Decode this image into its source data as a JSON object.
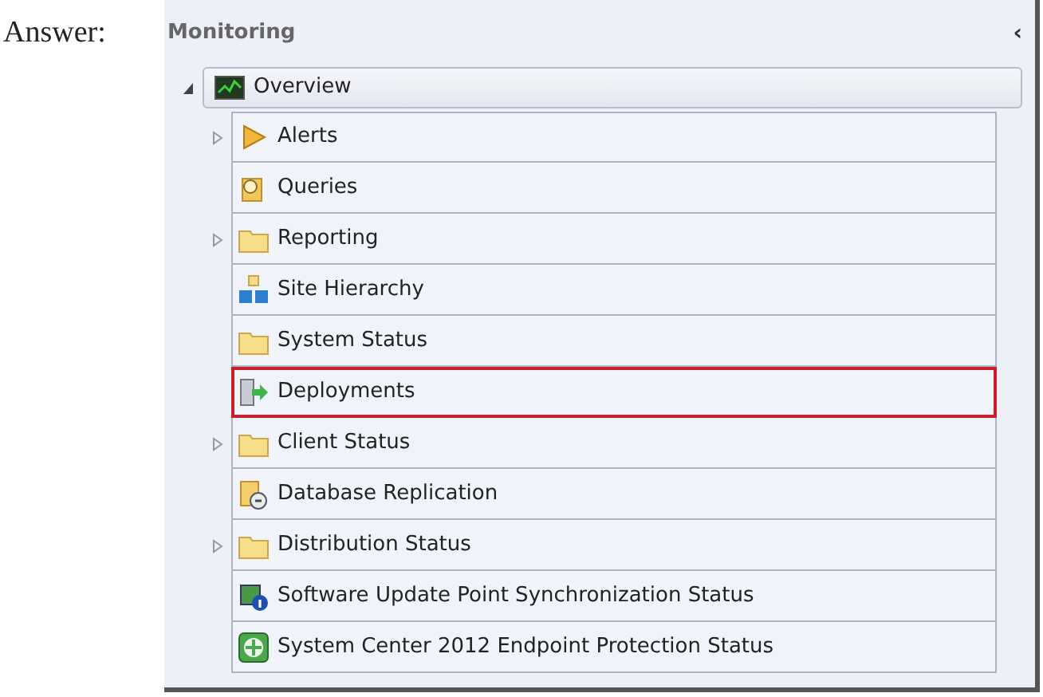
{
  "caption": "Answer:",
  "panel": {
    "title": "Monitoring",
    "collapse_glyph": "‹"
  },
  "tree": [
    {
      "label": "Overview",
      "kind": "overview",
      "expanded": true,
      "children": [
        {
          "label": "Alerts",
          "kind": "alerts",
          "expandable": true,
          "highlighted": false
        },
        {
          "label": "Queries",
          "kind": "queries",
          "expandable": false,
          "highlighted": false
        },
        {
          "label": "Reporting",
          "kind": "folder",
          "expandable": true,
          "highlighted": false
        },
        {
          "label": "Site Hierarchy",
          "kind": "hierarchy",
          "expandable": false,
          "highlighted": false
        },
        {
          "label": "System Status",
          "kind": "folder",
          "expandable": false,
          "highlighted": false
        },
        {
          "label": "Deployments",
          "kind": "deployments",
          "expandable": false,
          "highlighted": true
        },
        {
          "label": "Client Status",
          "kind": "folder",
          "expandable": true,
          "highlighted": false
        },
        {
          "label": "Database Replication",
          "kind": "database",
          "expandable": false,
          "highlighted": false
        },
        {
          "label": "Distribution Status",
          "kind": "folder",
          "expandable": true,
          "highlighted": false
        },
        {
          "label": "Software Update Point Synchronization Status",
          "kind": "sync",
          "expandable": false,
          "highlighted": false
        },
        {
          "label": "System Center 2012 Endpoint Protection Status",
          "kind": "endpoint",
          "expandable": false,
          "highlighted": false
        }
      ]
    }
  ]
}
